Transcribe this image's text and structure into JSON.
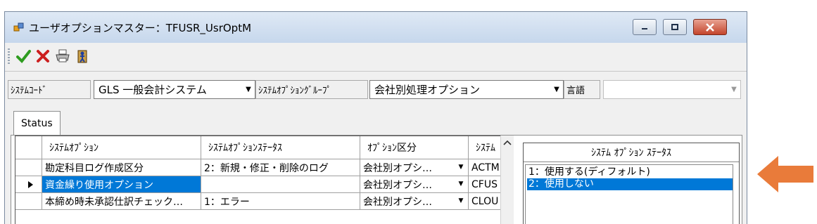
{
  "window": {
    "title": "ユーザオプションマスター：TFUSR_UsrOptM"
  },
  "toolbar": {
    "buttons": [
      {
        "name": "ok-check-icon",
        "color": "#2e9c1f"
      },
      {
        "name": "cancel-x-icon",
        "color": "#cc1f1f"
      },
      {
        "name": "print-icon",
        "color": "#555555"
      },
      {
        "name": "exit-door-icon",
        "color": "#1f3fa0"
      }
    ]
  },
  "filters": {
    "system_code_label": "ｼｽﾃﾑｺｰﾄﾞ",
    "system_code_value": "GLS 一般会計システム",
    "option_group_label": "ｼｽﾃﾑｵﾌﾟｼｮﾝｸﾞﾙｰﾌﾟ",
    "option_group_value": "会社別処理オプション",
    "language_label": "言語",
    "language_value": ""
  },
  "tabs": [
    "Status"
  ],
  "grid": {
    "columns": [
      "ｼｽﾃﾑｵﾌﾟｼｮﾝ",
      "ｼｽﾃﾑｵﾌﾟｼｮﾝｽﾃｰﾀｽ",
      "ｵﾌﾟｼｮﾝ区分",
      "ｼｽﾃﾑ"
    ],
    "rows": [
      {
        "option": "勘定科目ログ作成区分",
        "status": "2：新規・修正・削除のログ",
        "category": "会社別オプシ…",
        "system": "ACTM",
        "selected": false
      },
      {
        "option": "資金繰り使用オプション",
        "status": "",
        "category": "会社別オプシ…",
        "system": "CFUS",
        "selected": true
      },
      {
        "option": "本締め時未承認仕訳チェック…",
        "status": "1：エラー",
        "category": "会社別オプシ…",
        "system": "CLOU",
        "selected": false
      }
    ]
  },
  "status_panel": {
    "header": "ｼｽﾃﾑ ｵﾌﾟｼｮﾝ ｽﾃｰﾀｽ",
    "items": [
      {
        "label": "1：使用する(ディフォルト)",
        "selected": false
      },
      {
        "label": "2：使用しない",
        "selected": true
      }
    ]
  },
  "annotation": {
    "arrow_color": "#e97b3a",
    "direction": "left"
  }
}
